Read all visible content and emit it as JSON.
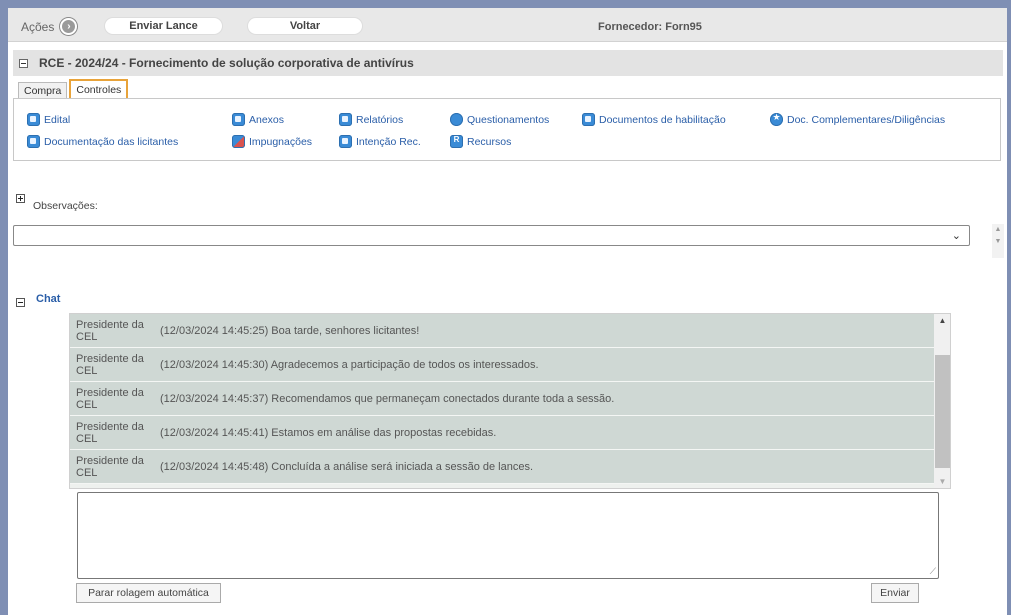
{
  "toolbar": {
    "acoes_label": "Ações",
    "acoes_icon": "chevron-right-icon",
    "enviar_lance_label": "Enviar Lance",
    "voltar_label": "Voltar",
    "fornecedor_label": "Fornecedor: Forn95"
  },
  "header": {
    "title": "RCE - 2024/24 - Fornecimento de solução corporativa de antivírus"
  },
  "tabs": [
    {
      "label": "Compra",
      "active": false
    },
    {
      "label": "Controles",
      "active": true
    }
  ],
  "controles": {
    "links": [
      {
        "label": "Edital",
        "icon": "document-icon"
      },
      {
        "label": "Anexos",
        "icon": "attachment-icon"
      },
      {
        "label": "Relatórios",
        "icon": "report-icon"
      },
      {
        "label": "Questionamentos",
        "icon": "question-icon"
      },
      {
        "label": "Documentos de habilitação",
        "icon": "document-icon"
      },
      {
        "label": "Doc. Complementares/Diligências",
        "icon": "star-icon"
      },
      {
        "label": "Documentação das licitantes",
        "icon": "document-icon"
      },
      {
        "label": "Impugnações",
        "icon": "impugnation-icon"
      },
      {
        "label": "Intenção Rec.",
        "icon": "document-icon"
      },
      {
        "label": "Recursos",
        "icon": "resource-icon"
      }
    ]
  },
  "observacoes": {
    "label": "Observações:",
    "selected_value": ""
  },
  "chat": {
    "label": "Chat",
    "messages": [
      {
        "author": "Presidente da CEL",
        "text": "(12/03/2024 14:45:25) Boa tarde, senhores licitantes!"
      },
      {
        "author": "Presidente da CEL",
        "text": "(12/03/2024 14:45:30) Agradecemos a participação de todos os interessados."
      },
      {
        "author": "Presidente da CEL",
        "text": "(12/03/2024 14:45:37) Recomendamos que permaneçam conectados durante toda a sessão."
      },
      {
        "author": "Presidente da CEL",
        "text": "(12/03/2024 14:45:41) Estamos em análise das propostas recebidas."
      },
      {
        "author": "Presidente da CEL",
        "text": "(12/03/2024 14:45:48) Concluída a análise será iniciada a sessão de lances."
      }
    ],
    "input_value": "",
    "stop_scroll_label": "Parar rolagem automática",
    "send_label": "Enviar"
  },
  "colors": {
    "background": "#7f8fb4",
    "link": "#2a5ea8",
    "tab_active_border": "#e8a33a",
    "chat_row": "#cfd8d4"
  }
}
